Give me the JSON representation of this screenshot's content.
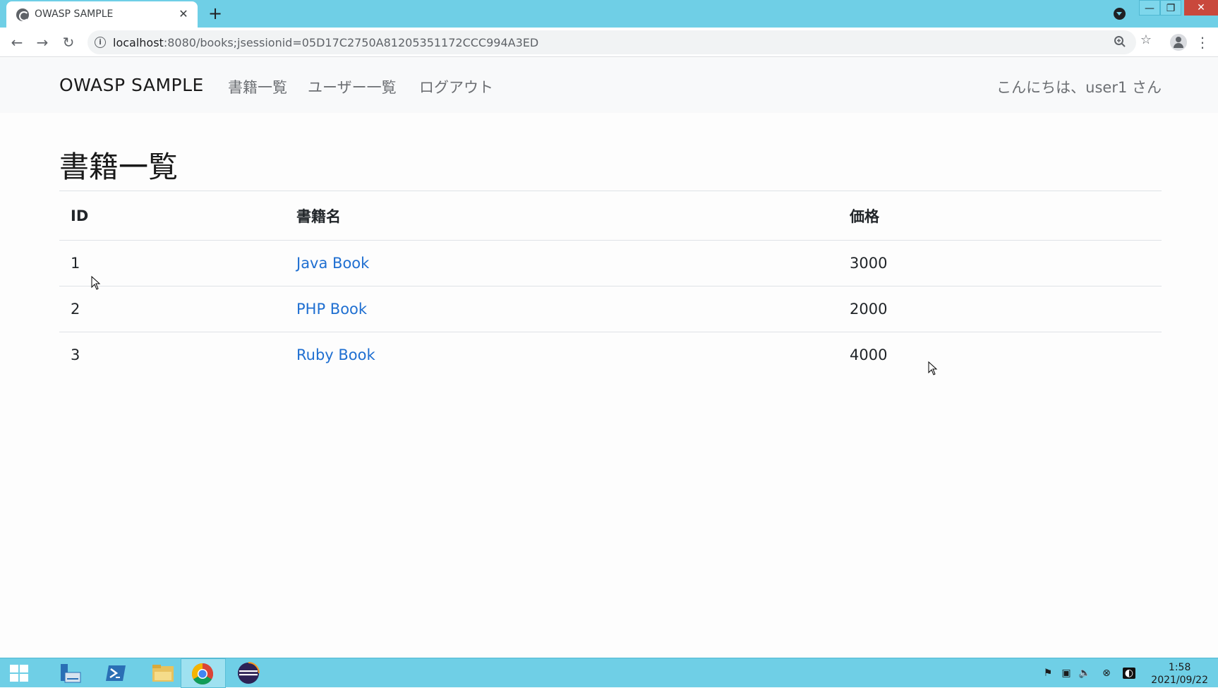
{
  "browser": {
    "tab_title": "OWASP SAMPLE",
    "tab_close": "✕",
    "new_tab": "+",
    "url_host": "localhost",
    "url_rest": ":8080/books;jsessionid=05D17C2750A81205351172CCC994A3ED",
    "back": "←",
    "forward": "→",
    "reload": "↻",
    "zoom_icon": "zoom-icon",
    "star_icon": "bookmark-star-icon",
    "menu": "⋮",
    "window_min": "—",
    "window_max": "❐",
    "window_close": "✕"
  },
  "navbar": {
    "brand": "OWASP SAMPLE",
    "links": [
      "書籍一覧",
      "ユーザー一覧",
      "ログアウト"
    ],
    "greeting": "こんにちは、user1 さん"
  },
  "page": {
    "heading": "書籍一覧",
    "table": {
      "headers": [
        "ID",
        "書籍名",
        "価格"
      ],
      "rows": [
        {
          "id": "1",
          "name": "Java Book",
          "price": "3000"
        },
        {
          "id": "2",
          "name": "PHP Book",
          "price": "2000"
        },
        {
          "id": "3",
          "name": "Ruby Book",
          "price": "4000"
        }
      ]
    }
  },
  "taskbar": {
    "time": "1:58",
    "date": "2021/09/22"
  },
  "colors": {
    "chrome_frame": "#6fcfe6",
    "link": "#1f6fd1",
    "navbar_bg": "#f8f9fa"
  }
}
